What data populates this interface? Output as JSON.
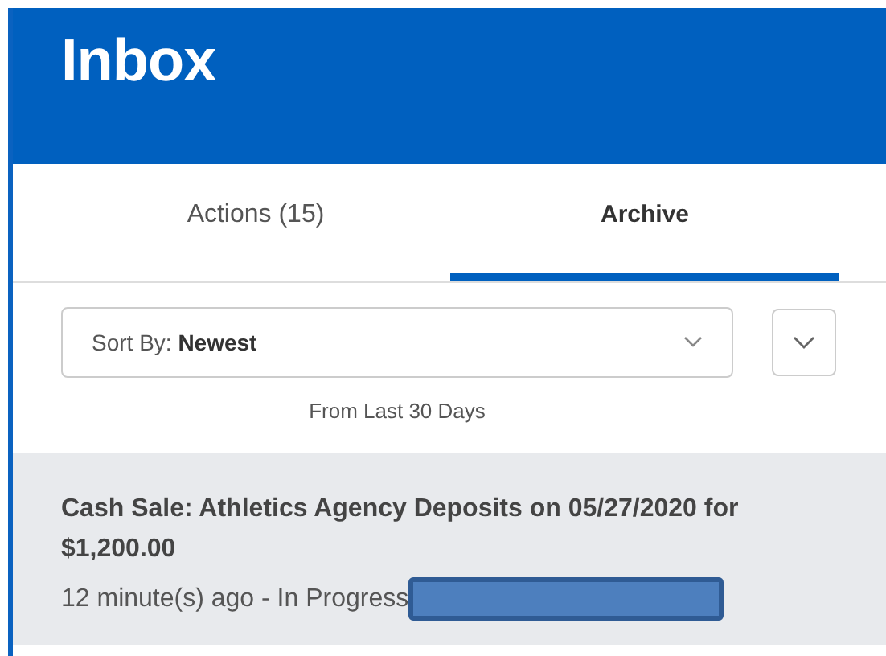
{
  "header": {
    "title": "Inbox"
  },
  "tabs": [
    {
      "label": "Actions (15)",
      "selected": false
    },
    {
      "label": "Archive",
      "selected": true
    }
  ],
  "sort": {
    "label": "Sort By:",
    "value": "Newest"
  },
  "range_note": "From Last 30 Days",
  "items": [
    {
      "title": "Cash Sale: Athletics Agency Deposits on 05/27/2020 for $1,200.00",
      "meta": "12 minute(s) ago - In Progress",
      "selected": true,
      "redacted": true
    }
  ]
}
